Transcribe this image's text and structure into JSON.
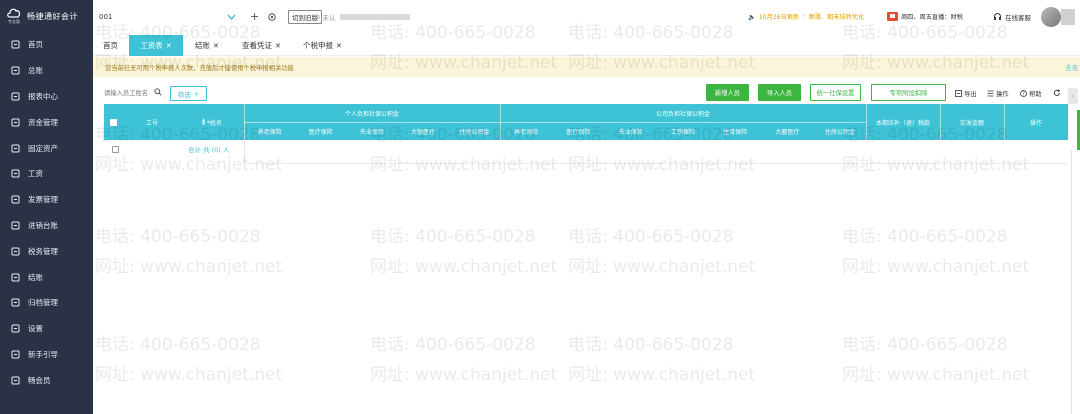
{
  "sidebar": {
    "logo_text": "畅捷通好会计",
    "logo_sub": "专业版",
    "items": [
      {
        "label": "首页",
        "icon": "home-icon"
      },
      {
        "label": "总账",
        "icon": "ledger-icon"
      },
      {
        "label": "报表中心",
        "icon": "chart-icon"
      },
      {
        "label": "资金管理",
        "icon": "wallet-icon"
      },
      {
        "label": "固定资产",
        "icon": "asset-icon"
      },
      {
        "label": "工资",
        "icon": "salary-icon"
      },
      {
        "label": "发票管理",
        "icon": "invoice-icon"
      },
      {
        "label": "进销台账",
        "icon": "inventory-icon"
      },
      {
        "label": "税务管理",
        "icon": "tax-icon"
      },
      {
        "label": "结账",
        "icon": "checkout-icon"
      },
      {
        "label": "归档管理",
        "icon": "archive-icon"
      },
      {
        "label": "设置",
        "icon": "settings-icon"
      },
      {
        "label": "新手引导",
        "icon": "guide-icon"
      },
      {
        "label": "畅会员",
        "icon": "vip-icon"
      }
    ]
  },
  "topbar": {
    "workspace": "001",
    "add_label": "+",
    "switch_label": "切到旧版",
    "status_label": "未认",
    "notice_date": "10月26日更新",
    "notice_text": "：摩薄、期末结转优化",
    "live_text": "周四、周五直播：财税",
    "support_label": "在线客服"
  },
  "tabs": [
    {
      "label": "首页",
      "active": false,
      "closable": false
    },
    {
      "label": "工资表",
      "active": true,
      "closable": true
    },
    {
      "label": "结账",
      "active": false,
      "closable": true
    },
    {
      "label": "查看凭证",
      "active": false,
      "closable": true
    },
    {
      "label": "个税申报",
      "active": false,
      "closable": true
    }
  ],
  "banner": {
    "text": "您当前已无可用个税申报人次数，充值后才能使用个税申报相关功能",
    "link": "去充"
  },
  "toolbar": {
    "search_placeholder": "请输入员工姓名",
    "filter_label": "筛选",
    "new_employee": "新增人员",
    "import_employee": "导入人员",
    "social_security": "统一社保设置",
    "special_deduction": "专项附加扣除",
    "export": "导出",
    "operate": "操作",
    "help": "帮助"
  },
  "table": {
    "col_id": "工号",
    "col_name": "*姓名",
    "group_personal": "个人负担社保公积金",
    "group_company": "公司负担社保公积金",
    "personal_cols": [
      "养老保险",
      "医疗保险",
      "失业保险",
      "大额医疗",
      "住房公积金"
    ],
    "company_cols": [
      "养老保险",
      "医疗保险",
      "失业保险",
      "工伤保险",
      "生育保险",
      "大额医疗",
      "住房公积金"
    ],
    "col_tax": "本期应补（退）税款",
    "col_net": "实发金额",
    "col_action": "操作",
    "total_text": "合计 共 (0) 人"
  },
  "watermark": {
    "phone": "电话: 400-665-0028",
    "site": "网址: www.chanjet.net"
  },
  "colors": {
    "sidebar": "#2b3246",
    "accent": "#3ec2d6",
    "green": "#3cb541",
    "notice": "#e8a100"
  }
}
